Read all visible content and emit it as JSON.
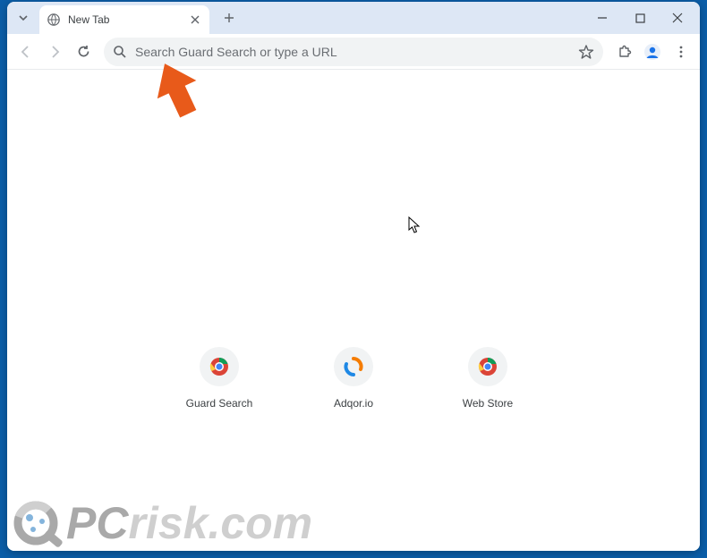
{
  "tab": {
    "title": "New Tab"
  },
  "omnibox": {
    "placeholder": "Search Guard Search or type a URL",
    "value": ""
  },
  "shortcuts": [
    {
      "label": "Guard Search",
      "icon": "chrome"
    },
    {
      "label": "Adqor.io",
      "icon": "adqor"
    },
    {
      "label": "Web Store",
      "icon": "chrome"
    }
  ],
  "watermark": {
    "prefix": "PC",
    "suffix": "risk.com"
  }
}
